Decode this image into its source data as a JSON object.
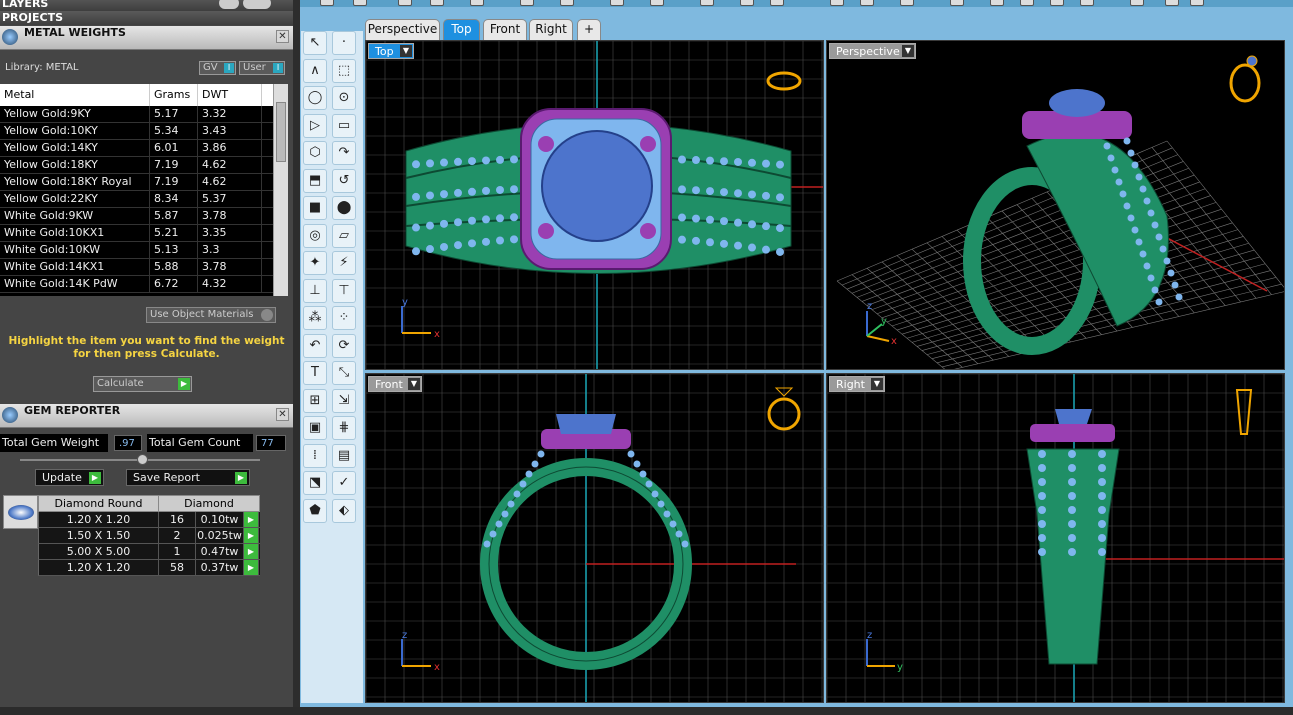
{
  "panels": {
    "layers_label": "LAYERS",
    "projects_label": "PROJECTS"
  },
  "metal_weights": {
    "title": "METAL WEIGHTS",
    "library_label": "Library: METAL",
    "gv_label": "GV",
    "user_label": "User",
    "columns": [
      "Metal",
      "Grams",
      "DWT"
    ],
    "rows": [
      {
        "metal": "Yellow Gold:9KY",
        "grams": "5.17",
        "dwt": "3.32"
      },
      {
        "metal": "Yellow Gold:10KY",
        "grams": "5.34",
        "dwt": "3.43"
      },
      {
        "metal": "Yellow Gold:14KY",
        "grams": "6.01",
        "dwt": "3.86"
      },
      {
        "metal": "Yellow Gold:18KY",
        "grams": "7.19",
        "dwt": "4.62"
      },
      {
        "metal": "Yellow Gold:18KY Royal",
        "grams": "7.19",
        "dwt": "4.62"
      },
      {
        "metal": "Yellow Gold:22KY",
        "grams": "8.34",
        "dwt": "5.37"
      },
      {
        "metal": "White Gold:9KW",
        "grams": "5.87",
        "dwt": "3.78"
      },
      {
        "metal": "White Gold:10KX1",
        "grams": "5.21",
        "dwt": "3.35"
      },
      {
        "metal": "White Gold:10KW",
        "grams": "5.13",
        "dwt": "3.3"
      },
      {
        "metal": "White Gold:14KX1",
        "grams": "5.88",
        "dwt": "3.78"
      },
      {
        "metal": "White Gold:14K PdW",
        "grams": "6.72",
        "dwt": "4.32"
      }
    ],
    "use_object_materials": "Use Object Materials",
    "hint": "Highlight the item you want to find the weight for then press Calculate.",
    "calculate_label": "Calculate"
  },
  "gem_reporter": {
    "title": "GEM REPORTER",
    "total_weight_label": "Total Gem Weight",
    "total_weight_value": ".97",
    "total_count_label": "Total Gem Count",
    "total_count_value": "77",
    "update_label": "Update",
    "save_report_label": "Save Report",
    "headers": [
      "Diamond Round",
      "Diamond"
    ],
    "rows": [
      {
        "size": "1.20 X 1.20",
        "count": "16",
        "weight": "0.10tw"
      },
      {
        "size": "1.50 X 1.50",
        "count": "2",
        "weight": "0.025tw"
      },
      {
        "size": "5.00 X 5.00",
        "count": "1",
        "weight": "0.47tw"
      },
      {
        "size": "1.20 X 1.20",
        "count": "58",
        "weight": "0.37tw"
      }
    ]
  },
  "tabs": [
    "Perspective",
    "Top",
    "Front",
    "Right",
    "+"
  ],
  "active_tab": "Top",
  "viewports": {
    "top": {
      "label": "Top",
      "axis_a": "y",
      "axis_b": "x"
    },
    "perspective": {
      "label": "Perspective",
      "axis_a": "z",
      "axis_b": "y",
      "axis_c": "x"
    },
    "front": {
      "label": "Front",
      "axis_a": "z",
      "axis_b": "x"
    },
    "right": {
      "label": "Right",
      "axis_a": "z",
      "axis_b": "y"
    }
  },
  "colors": {
    "metal": "#1f8f66",
    "stones": "#7fb6ee",
    "halo": "#9a3fb2",
    "center_stone": "#4d74cc",
    "grid": "#4a4a4a",
    "accent": "#1e90e0",
    "hint_text": "#f5d442"
  }
}
